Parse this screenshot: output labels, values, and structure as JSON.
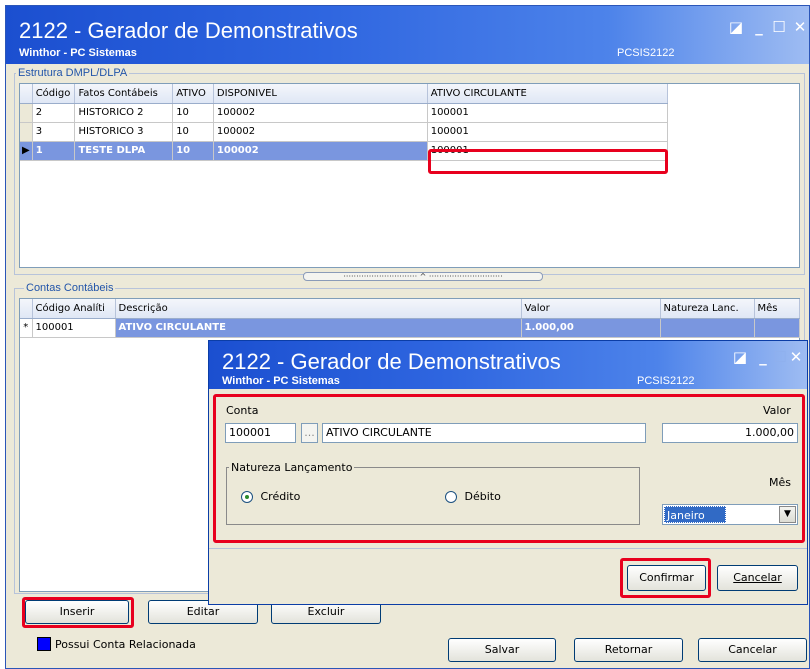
{
  "window": {
    "title": "2122 - Gerador de Demonstrativos",
    "subtitle": "Winthor - PC Sistemas",
    "code": "PCSIS2122"
  },
  "estrutura": {
    "label": "Estrutura DMPL/DLPA",
    "columns": [
      "Código",
      "Fatos Contábeis",
      "ATIVO",
      "DISPONIVEL",
      "ATIVO CIRCULANTE"
    ],
    "rows": [
      [
        "2",
        "HISTORICO 2",
        "10",
        "100002",
        "100001"
      ],
      [
        "3",
        "HISTORICO 3",
        "10",
        "100002",
        "100001"
      ],
      [
        "1",
        "TESTE DLPA",
        "10",
        "100002",
        "100001"
      ]
    ]
  },
  "contas": {
    "label": "Contas Contábeis",
    "columns": [
      "Código Analíti",
      "Descrição",
      "Valor",
      "Natureza Lanc.",
      "Mês"
    ],
    "row": [
      "100001",
      "ATIVO CIRCULANTE",
      "1.000,00"
    ],
    "new_row_marker": "*"
  },
  "dialog": {
    "title": "2122 - Gerador de Demonstrativos",
    "subtitle": "Winthor - PC Sistemas",
    "code": "PCSIS2122",
    "conta_label": "Conta",
    "conta_code": "100001",
    "browse_label": "...",
    "conta_desc": "ATIVO CIRCULANTE",
    "valor_label": "Valor",
    "valor_value": "1.000,00",
    "natureza_label": "Natureza Lançamento",
    "credito_label": "Crédito",
    "debito_label": "Débito",
    "mes_label": "Mês",
    "mes_value": "Janeiro",
    "confirm_label": "Confirmar",
    "cancel_label": "Cancelar"
  },
  "buttons": {
    "inserir": "Inserir",
    "editar": "Editar",
    "excluir": "Excluir",
    "salvar": "Salvar",
    "retornar": "Retornar",
    "cancelar": "Cancelar"
  },
  "legend": {
    "text": "Possui Conta Relacionada",
    "color": "#0000ff"
  },
  "colors": {
    "selected_row": "#7a96df",
    "highlight": "#e8001e"
  }
}
